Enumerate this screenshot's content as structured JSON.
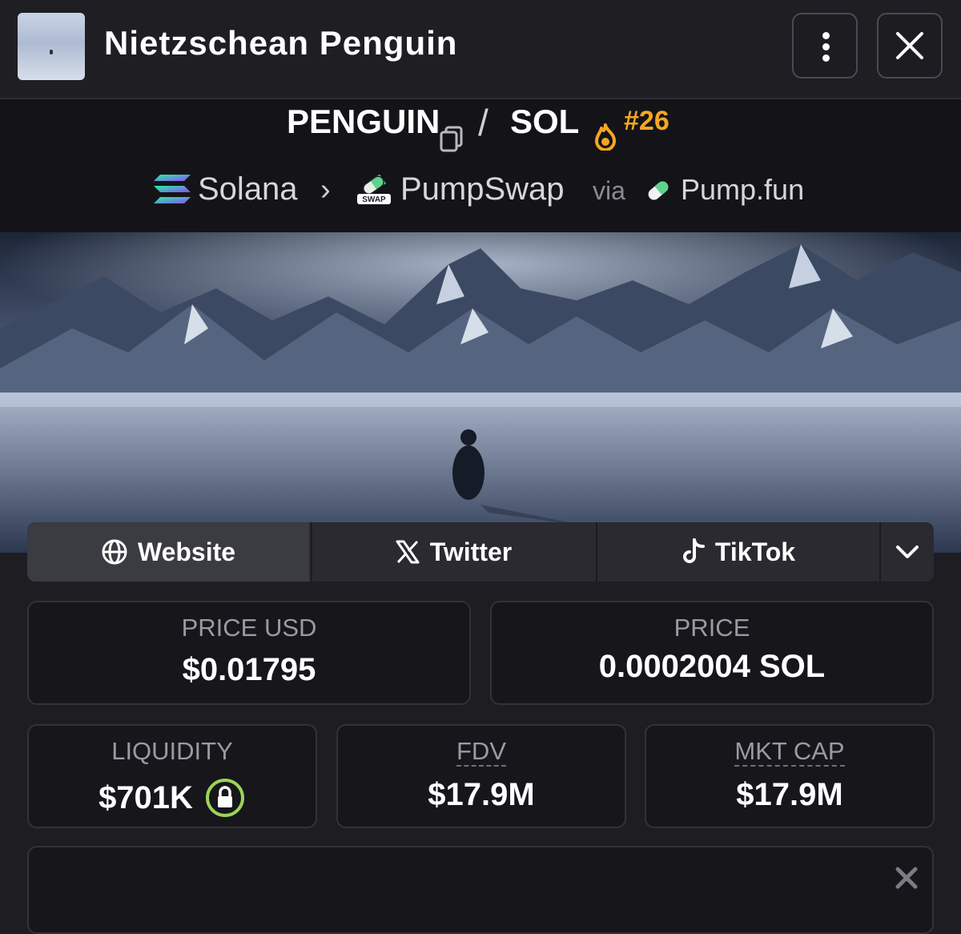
{
  "header": {
    "title": "Nietzschean Penguin",
    "thumbnail": "penguin-thumbnail",
    "more_icon": "vertical-dots-icon",
    "close_icon": "close-icon"
  },
  "pair": {
    "base": "PENGUIN",
    "separator": "/",
    "quote": "SOL",
    "rank": "#26",
    "rank_color": "#f5a623",
    "chain": "Solana",
    "dex": "PumpSwap",
    "dex_badge": "SWAP",
    "via": "via",
    "launchpad": "Pump.fun"
  },
  "links": {
    "website": "Website",
    "twitter": "Twitter",
    "tiktok": "TikTok"
  },
  "stats": {
    "price_usd_label": "PRICE USD",
    "price_usd": "$0.01795",
    "price_native_label": "PRICE",
    "price_native": "0.0002004 SOL",
    "liquidity_label": "LIQUIDITY",
    "liquidity": "$701K",
    "fdv_label": "FDV",
    "fdv": "$17.9M",
    "mkt_cap_label": "MKT CAP",
    "mkt_cap": "$17.9M"
  },
  "colors": {
    "background": "#1d1d22",
    "header_bg": "#141418",
    "accent_orange": "#f5a623",
    "lock_green": "#9bd35a"
  }
}
